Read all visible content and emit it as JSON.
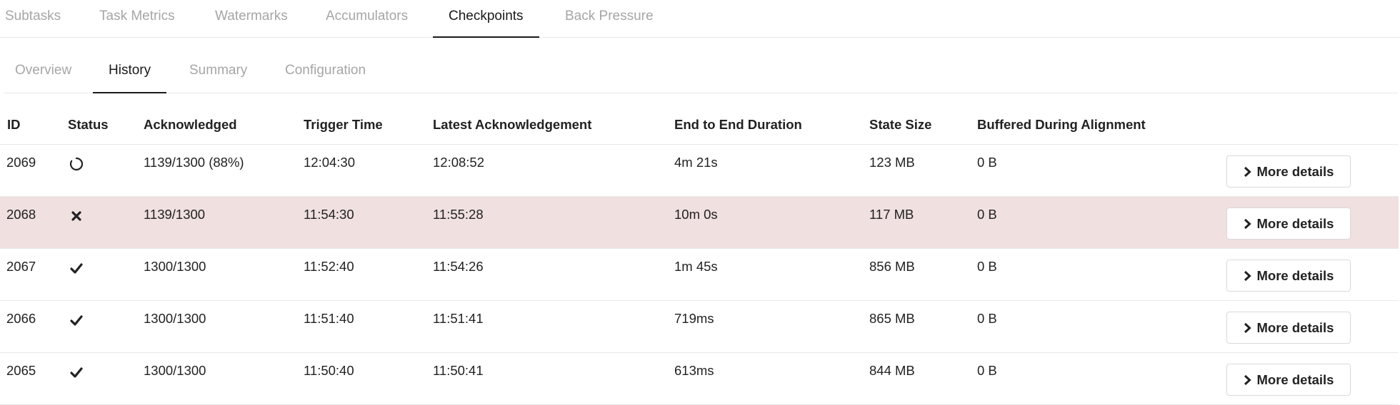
{
  "top_tabs": [
    {
      "label": "Subtasks",
      "active": false
    },
    {
      "label": "Task Metrics",
      "active": false
    },
    {
      "label": "Watermarks",
      "active": false
    },
    {
      "label": "Accumulators",
      "active": false
    },
    {
      "label": "Checkpoints",
      "active": true
    },
    {
      "label": "Back Pressure",
      "active": false
    }
  ],
  "sub_tabs": [
    {
      "label": "Overview",
      "active": false
    },
    {
      "label": "History",
      "active": true
    },
    {
      "label": "Summary",
      "active": false
    },
    {
      "label": "Configuration",
      "active": false
    }
  ],
  "table": {
    "headers": {
      "id": "ID",
      "status": "Status",
      "acknowledged": "Acknowledged",
      "trigger_time": "Trigger Time",
      "latest_ack": "Latest Acknowledgement",
      "duration": "End to End Duration",
      "state_size": "State Size",
      "buffered": "Buffered During Alignment"
    },
    "rows": [
      {
        "id": "2069",
        "status": "in-progress",
        "acknowledged": "1139/1300 (88%)",
        "trigger_time": "12:04:30",
        "latest_ack": "12:08:52",
        "duration": "4m 21s",
        "state_size": "123 MB",
        "buffered": "0 B",
        "button": "More details"
      },
      {
        "id": "2068",
        "status": "failed",
        "acknowledged": "1139/1300",
        "trigger_time": "11:54:30",
        "latest_ack": "11:55:28",
        "duration": "10m 0s",
        "state_size": "117 MB",
        "buffered": "0 B",
        "button": "More details"
      },
      {
        "id": "2067",
        "status": "completed",
        "acknowledged": "1300/1300",
        "trigger_time": "11:52:40",
        "latest_ack": "11:54:26",
        "duration": "1m 45s",
        "state_size": "856 MB",
        "buffered": "0 B",
        "button": "More details"
      },
      {
        "id": "2066",
        "status": "completed",
        "acknowledged": "1300/1300",
        "trigger_time": "11:51:40",
        "latest_ack": "11:51:41",
        "duration": "719ms",
        "state_size": "865 MB",
        "buffered": "0 B",
        "button": "More details"
      },
      {
        "id": "2065",
        "status": "completed",
        "acknowledged": "1300/1300",
        "trigger_time": "11:50:40",
        "latest_ack": "11:50:41",
        "duration": "613ms",
        "state_size": "844 MB",
        "buffered": "0 B",
        "button": "More details"
      }
    ]
  },
  "colors": {
    "failed_row_bg": "#f0e0e0",
    "active_tab": "#1a1a1a",
    "inactive_tab": "#a6a6a6"
  }
}
